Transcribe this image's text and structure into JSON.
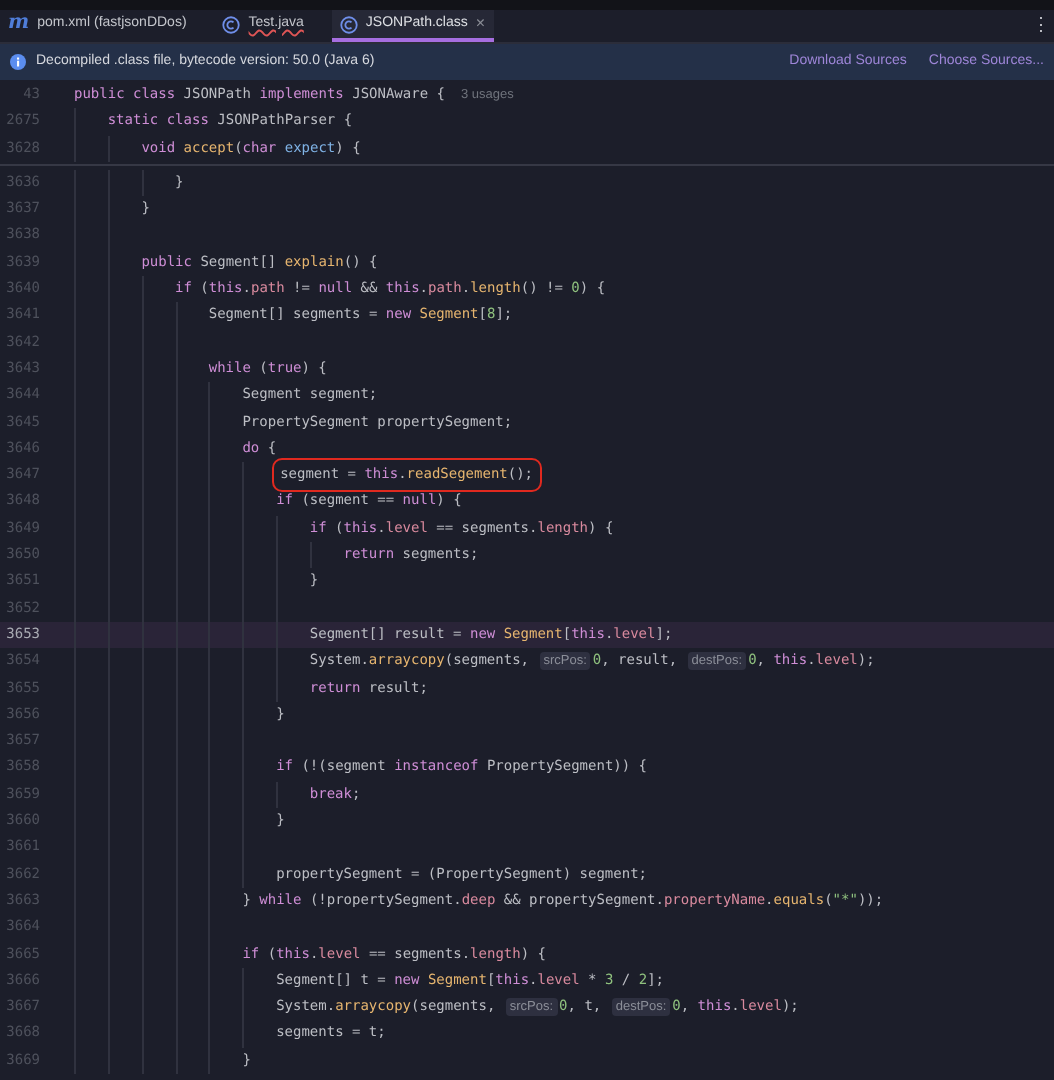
{
  "tabs": [
    {
      "label": "pom.xml (fastjsonDDos)",
      "kind": "maven",
      "icon_text": "m",
      "selected": false,
      "error": false
    },
    {
      "label": "Test.java",
      "kind": "class",
      "selected": false,
      "error": true
    },
    {
      "label": "JSONPath.class",
      "kind": "class",
      "selected": true,
      "error": false,
      "close": "×"
    }
  ],
  "menu": "⋮",
  "banner": {
    "text": "Decompiled .class file, bytecode version: 50.0 (Java 6)",
    "links": [
      "Download Sources",
      "Choose Sources..."
    ]
  },
  "sticky_lines": [
    {
      "number": "43",
      "usages": "3 usages",
      "tokens": [
        {
          "kind": "kw",
          "text": "public class"
        },
        {
          "kind": "plain",
          "text": " JSONPath "
        },
        {
          "kind": "kw",
          "text": "implements"
        },
        {
          "kind": "plain",
          "text": " JSONAware {"
        }
      ],
      "children": [
        {
          "number": "2675",
          "tokens": [
            {
              "kind": "kw",
              "text": "static class"
            },
            {
              "kind": "plain",
              "text": " JSONPathParser {"
            }
          ],
          "children": [
            {
              "number": "3628",
              "tokens": [
                {
                  "kind": "kw",
                  "text": "void "
                },
                {
                  "kind": "fn",
                  "text": "accept"
                },
                {
                  "kind": "plain",
                  "text": "("
                },
                {
                  "kind": "kw",
                  "text": "char "
                },
                {
                  "kind": "param",
                  "text": "expect"
                },
                {
                  "kind": "plain",
                  "text": ") {"
                }
              ]
            }
          ]
        }
      ]
    }
  ],
  "lines": [
    {
      "children": [
        {
          "number": "3636",
          "current": false,
          "boxed": false,
          "tokens": [
            {
              "kind": "plain",
              "text": "}"
            }
          ]
        }
      ]
    },
    {
      "number": "3637",
      "current": false,
      "boxed": false,
      "tokens": [
        {
          "kind": "plain",
          "text": "}"
        }
      ]
    },
    {
      "number": "3638",
      "current": false,
      "boxed": false
    },
    {
      "number": "3639",
      "current": false,
      "boxed": false,
      "tokens": [
        {
          "kind": "kw",
          "text": "public"
        },
        {
          "kind": "plain",
          "text": " Segment[] "
        },
        {
          "kind": "fn",
          "text": "explain"
        },
        {
          "kind": "plain",
          "text": "() {"
        }
      ],
      "children": [
        {
          "number": "3640",
          "current": false,
          "boxed": false,
          "tokens": [
            {
              "kind": "kw",
              "text": "if"
            },
            {
              "kind": "plain",
              "text": " ("
            },
            {
              "kind": "kw",
              "text": "this"
            },
            {
              "kind": "plain",
              "text": "."
            },
            {
              "kind": "field",
              "text": "path"
            },
            {
              "kind": "plain",
              "text": " != "
            },
            {
              "kind": "kw",
              "text": "null"
            },
            {
              "kind": "plain",
              "text": " && "
            },
            {
              "kind": "kw",
              "text": "this"
            },
            {
              "kind": "plain",
              "text": "."
            },
            {
              "kind": "field",
              "text": "path"
            },
            {
              "kind": "plain",
              "text": "."
            },
            {
              "kind": "fn",
              "text": "length"
            },
            {
              "kind": "plain",
              "text": "() != "
            },
            {
              "kind": "num",
              "text": "0"
            },
            {
              "kind": "plain",
              "text": ") {"
            }
          ],
          "children": [
            {
              "number": "3641",
              "current": false,
              "boxed": false,
              "tokens": [
                {
                  "kind": "plain",
                  "text": "Segment[] segments = "
                },
                {
                  "kind": "kw",
                  "text": "new "
                },
                {
                  "kind": "fn",
                  "text": "Segment"
                },
                {
                  "kind": "plain",
                  "text": "["
                },
                {
                  "kind": "num",
                  "text": "8"
                },
                {
                  "kind": "plain",
                  "text": "];"
                }
              ]
            },
            {
              "number": "3642",
              "current": false,
              "boxed": false
            },
            {
              "number": "3643",
              "current": false,
              "boxed": false,
              "tokens": [
                {
                  "kind": "kw",
                  "text": "while"
                },
                {
                  "kind": "plain",
                  "text": " ("
                },
                {
                  "kind": "kw",
                  "text": "true"
                },
                {
                  "kind": "plain",
                  "text": ") {"
                }
              ],
              "children": [
                {
                  "number": "3644",
                  "current": false,
                  "boxed": false,
                  "tokens": [
                    {
                      "kind": "plain",
                      "text": "Segment segment;"
                    }
                  ]
                },
                {
                  "number": "3645",
                  "current": false,
                  "boxed": false,
                  "tokens": [
                    {
                      "kind": "plain",
                      "text": "PropertySegment propertySegment;"
                    }
                  ]
                },
                {
                  "number": "3646",
                  "current": false,
                  "boxed": false,
                  "tokens": [
                    {
                      "kind": "kw",
                      "text": "do"
                    },
                    {
                      "kind": "plain",
                      "text": " {"
                    }
                  ],
                  "children": [
                    {
                      "number": "3647",
                      "current": false,
                      "boxed": true,
                      "tokens": [
                        {
                          "kind": "plain",
                          "text": "segment = "
                        },
                        {
                          "kind": "kw",
                          "text": "this"
                        },
                        {
                          "kind": "plain",
                          "text": "."
                        },
                        {
                          "kind": "fn",
                          "text": "readSegement"
                        },
                        {
                          "kind": "plain",
                          "text": "();"
                        }
                      ]
                    },
                    {
                      "number": "3648",
                      "current": false,
                      "boxed": false,
                      "tokens": [
                        {
                          "kind": "kw",
                          "text": "if"
                        },
                        {
                          "kind": "plain",
                          "text": " (segment == "
                        },
                        {
                          "kind": "kw",
                          "text": "null"
                        },
                        {
                          "kind": "plain",
                          "text": ") {"
                        }
                      ],
                      "children": [
                        {
                          "number": "3649",
                          "current": false,
                          "boxed": false,
                          "tokens": [
                            {
                              "kind": "kw",
                              "text": "if"
                            },
                            {
                              "kind": "plain",
                              "text": " ("
                            },
                            {
                              "kind": "kw",
                              "text": "this"
                            },
                            {
                              "kind": "plain",
                              "text": "."
                            },
                            {
                              "kind": "field",
                              "text": "level"
                            },
                            {
                              "kind": "plain",
                              "text": " == segments."
                            },
                            {
                              "kind": "field",
                              "text": "length"
                            },
                            {
                              "kind": "plain",
                              "text": ") {"
                            }
                          ],
                          "children": [
                            {
                              "number": "3650",
                              "current": false,
                              "boxed": false,
                              "tokens": [
                                {
                                  "kind": "kw",
                                  "text": "return"
                                },
                                {
                                  "kind": "plain",
                                  "text": " segments;"
                                }
                              ]
                            }
                          ]
                        },
                        {
                          "number": "3651",
                          "current": false,
                          "boxed": false,
                          "tokens": [
                            {
                              "kind": "plain",
                              "text": "}"
                            }
                          ]
                        },
                        {
                          "number": "3652",
                          "current": false,
                          "boxed": false
                        },
                        {
                          "number": "3653",
                          "current": true,
                          "boxed": false,
                          "tokens": [
                            {
                              "kind": "plain",
                              "text": "Segment[] result = "
                            },
                            {
                              "kind": "kw",
                              "text": "new "
                            },
                            {
                              "kind": "fn",
                              "text": "Segment"
                            },
                            {
                              "kind": "plain",
                              "text": "["
                            },
                            {
                              "kind": "kw",
                              "text": "this"
                            },
                            {
                              "kind": "plain",
                              "text": "."
                            },
                            {
                              "kind": "field",
                              "text": "level"
                            },
                            {
                              "kind": "plain",
                              "text": "];"
                            }
                          ]
                        },
                        {
                          "number": "3654",
                          "current": false,
                          "boxed": false,
                          "tokens": [
                            {
                              "kind": "plain",
                              "text": "System."
                            },
                            {
                              "kind": "fn",
                              "text": "arraycopy"
                            },
                            {
                              "kind": "plain",
                              "text": "(segments, "
                            },
                            {
                              "kind": "hint",
                              "text": "srcPos:"
                            },
                            {
                              "kind": "num",
                              "text": "0"
                            },
                            {
                              "kind": "plain",
                              "text": ", result, "
                            },
                            {
                              "kind": "hint",
                              "text": "destPos:"
                            },
                            {
                              "kind": "num",
                              "text": "0"
                            },
                            {
                              "kind": "plain",
                              "text": ", "
                            },
                            {
                              "kind": "kw",
                              "text": "this"
                            },
                            {
                              "kind": "plain",
                              "text": "."
                            },
                            {
                              "kind": "field",
                              "text": "level"
                            },
                            {
                              "kind": "plain",
                              "text": ");"
                            }
                          ]
                        },
                        {
                          "number": "3655",
                          "current": false,
                          "boxed": false,
                          "tokens": [
                            {
                              "kind": "kw",
                              "text": "return"
                            },
                            {
                              "kind": "plain",
                              "text": " result;"
                            }
                          ]
                        }
                      ]
                    },
                    {
                      "number": "3656",
                      "current": false,
                      "boxed": false,
                      "tokens": [
                        {
                          "kind": "plain",
                          "text": "}"
                        }
                      ]
                    },
                    {
                      "number": "3657",
                      "current": false,
                      "boxed": false
                    },
                    {
                      "number": "3658",
                      "current": false,
                      "boxed": false,
                      "tokens": [
                        {
                          "kind": "kw",
                          "text": "if"
                        },
                        {
                          "kind": "plain",
                          "text": " (!(segment "
                        },
                        {
                          "kind": "kw",
                          "text": "instanceof"
                        },
                        {
                          "kind": "plain",
                          "text": " PropertySegment)) {"
                        }
                      ],
                      "children": [
                        {
                          "number": "3659",
                          "current": false,
                          "boxed": false,
                          "tokens": [
                            {
                              "kind": "kw",
                              "text": "break"
                            },
                            {
                              "kind": "plain",
                              "text": ";"
                            }
                          ]
                        }
                      ]
                    },
                    {
                      "number": "3660",
                      "current": false,
                      "boxed": false,
                      "tokens": [
                        {
                          "kind": "plain",
                          "text": "}"
                        }
                      ]
                    },
                    {
                      "number": "3661",
                      "current": false,
                      "boxed": false
                    },
                    {
                      "number": "3662",
                      "current": false,
                      "boxed": false,
                      "tokens": [
                        {
                          "kind": "plain",
                          "text": "propertySegment = (PropertySegment) segment;"
                        }
                      ]
                    }
                  ]
                },
                {
                  "number": "3663",
                  "current": false,
                  "boxed": false,
                  "tokens": [
                    {
                      "kind": "plain",
                      "text": "} "
                    },
                    {
                      "kind": "kw",
                      "text": "while"
                    },
                    {
                      "kind": "plain",
                      "text": " (!propertySegment."
                    },
                    {
                      "kind": "field",
                      "text": "deep"
                    },
                    {
                      "kind": "plain",
                      "text": " && propertySegment."
                    },
                    {
                      "kind": "field",
                      "text": "propertyName"
                    },
                    {
                      "kind": "plain",
                      "text": "."
                    },
                    {
                      "kind": "fn",
                      "text": "equals"
                    },
                    {
                      "kind": "plain",
                      "text": "("
                    },
                    {
                      "kind": "str",
                      "text": "\"*\""
                    },
                    {
                      "kind": "plain",
                      "text": "));"
                    }
                  ]
                },
                {
                  "number": "3664",
                  "current": false,
                  "boxed": false
                },
                {
                  "number": "3665",
                  "current": false,
                  "boxed": false,
                  "tokens": [
                    {
                      "kind": "kw",
                      "text": "if"
                    },
                    {
                      "kind": "plain",
                      "text": " ("
                    },
                    {
                      "kind": "kw",
                      "text": "this"
                    },
                    {
                      "kind": "plain",
                      "text": "."
                    },
                    {
                      "kind": "field",
                      "text": "level"
                    },
                    {
                      "kind": "plain",
                      "text": " == segments."
                    },
                    {
                      "kind": "field",
                      "text": "length"
                    },
                    {
                      "kind": "plain",
                      "text": ") {"
                    }
                  ],
                  "children": [
                    {
                      "number": "3666",
                      "current": false,
                      "boxed": false,
                      "tokens": [
                        {
                          "kind": "plain",
                          "text": "Segment[] t = "
                        },
                        {
                          "kind": "kw",
                          "text": "new "
                        },
                        {
                          "kind": "fn",
                          "text": "Segment"
                        },
                        {
                          "kind": "plain",
                          "text": "["
                        },
                        {
                          "kind": "kw",
                          "text": "this"
                        },
                        {
                          "kind": "plain",
                          "text": "."
                        },
                        {
                          "kind": "field",
                          "text": "level"
                        },
                        {
                          "kind": "plain",
                          "text": " * "
                        },
                        {
                          "kind": "num",
                          "text": "3"
                        },
                        {
                          "kind": "plain",
                          "text": " / "
                        },
                        {
                          "kind": "num",
                          "text": "2"
                        },
                        {
                          "kind": "plain",
                          "text": "];"
                        }
                      ]
                    },
                    {
                      "number": "3667",
                      "current": false,
                      "boxed": false,
                      "tokens": [
                        {
                          "kind": "plain",
                          "text": "System."
                        },
                        {
                          "kind": "fn",
                          "text": "arraycopy"
                        },
                        {
                          "kind": "plain",
                          "text": "(segments, "
                        },
                        {
                          "kind": "hint",
                          "text": "srcPos:"
                        },
                        {
                          "kind": "num",
                          "text": "0"
                        },
                        {
                          "kind": "plain",
                          "text": ", t, "
                        },
                        {
                          "kind": "hint",
                          "text": "destPos:"
                        },
                        {
                          "kind": "num",
                          "text": "0"
                        },
                        {
                          "kind": "plain",
                          "text": ", "
                        },
                        {
                          "kind": "kw",
                          "text": "this"
                        },
                        {
                          "kind": "plain",
                          "text": "."
                        },
                        {
                          "kind": "field",
                          "text": "level"
                        },
                        {
                          "kind": "plain",
                          "text": ");"
                        }
                      ]
                    },
                    {
                      "number": "3668",
                      "current": false,
                      "boxed": false,
                      "tokens": [
                        {
                          "kind": "plain",
                          "text": "segments = t;"
                        }
                      ]
                    }
                  ]
                },
                {
                  "number": "3669",
                  "current": false,
                  "boxed": false,
                  "tokens": [
                    {
                      "kind": "plain",
                      "text": "}"
                    }
                  ]
                }
              ]
            }
          ]
        }
      ]
    }
  ]
}
